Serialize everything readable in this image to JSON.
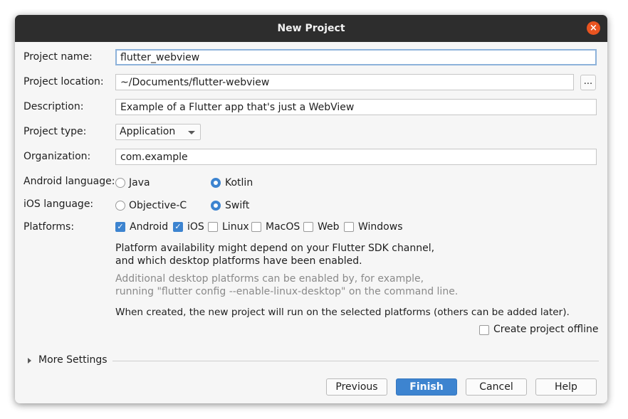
{
  "window": {
    "title": "New Project",
    "close_glyph": "×",
    "close_icon": "close-icon"
  },
  "form": {
    "project_name": {
      "label": "Project name:",
      "value": "flutter_webview"
    },
    "project_location": {
      "label": "Project location:",
      "value": "~/Documents/flutter-webview",
      "browse_label": "..."
    },
    "description": {
      "label": "Description:",
      "value": "Example of a Flutter app that's just a WebView"
    },
    "project_type": {
      "label": "Project type:",
      "selected": "Application"
    },
    "organization": {
      "label": "Organization:",
      "value": "com.example"
    },
    "android_language": {
      "label": "Android language:",
      "options": [
        {
          "label": "Java",
          "checked": false
        },
        {
          "label": "Kotlin",
          "checked": true
        }
      ]
    },
    "ios_language": {
      "label": "iOS language:",
      "options": [
        {
          "label": "Objective-C",
          "checked": false
        },
        {
          "label": "Swift",
          "checked": true
        }
      ]
    },
    "platforms": {
      "label": "Platforms:",
      "options": [
        {
          "label": "Android",
          "checked": true
        },
        {
          "label": "iOS",
          "checked": true
        },
        {
          "label": "Linux",
          "checked": false
        },
        {
          "label": "MacOS",
          "checked": false
        },
        {
          "label": "Web",
          "checked": false
        },
        {
          "label": "Windows",
          "checked": false
        }
      ]
    },
    "notes": {
      "availability_line1": "Platform availability might depend on your Flutter SDK channel,",
      "availability_line2": "and which desktop platforms have been enabled.",
      "additional_line1": "Additional desktop platforms can be enabled by, for example,",
      "additional_line2": "running \"flutter config --enable-linux-desktop\" on the command line.",
      "created_note": "When created, the new project will run on the selected platforms (others can be added later)."
    },
    "create_offline": {
      "label": "Create project offline",
      "checked": false
    },
    "more_settings": {
      "label": "More Settings"
    }
  },
  "buttons": {
    "previous": "Previous",
    "finish": "Finish",
    "cancel": "Cancel",
    "help": "Help"
  },
  "colors": {
    "accent": "#3d84d0",
    "close": "#e95420",
    "titlebar": "#2d2d2d"
  },
  "icons": {
    "check_glyph": "✓"
  }
}
